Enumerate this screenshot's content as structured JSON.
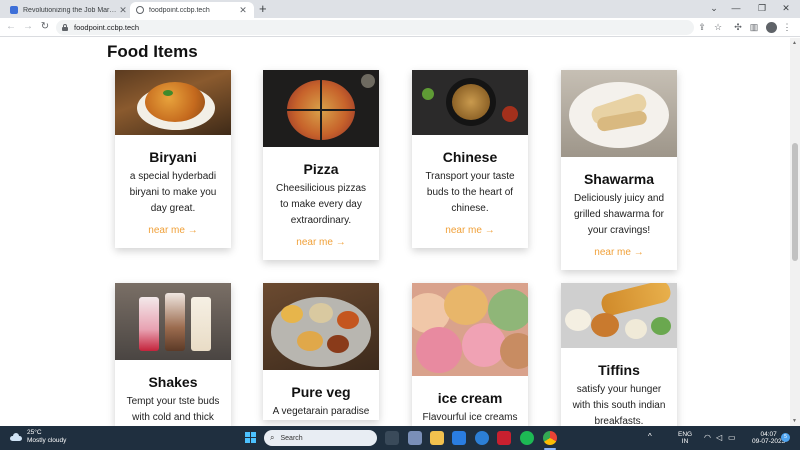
{
  "browser": {
    "tabs": [
      {
        "title": "Revolutionizing the Job Market |",
        "active": false
      },
      {
        "title": "foodpoint.ccbp.tech",
        "active": true
      }
    ],
    "new_tab": "+",
    "url": "foodpoint.ccbp.tech",
    "window_controls": [
      "⌄",
      "—",
      "❐",
      "✕"
    ]
  },
  "page": {
    "section_title": "Food Items",
    "cards": [
      {
        "name": "Biryani",
        "description": "a special hyderbadi biryani to make you day great.",
        "cta": "near me →"
      },
      {
        "name": "Pizza",
        "description": "Cheesilicious pizzas to make every day extraordinary.",
        "cta": "near me →"
      },
      {
        "name": "Chinese",
        "description": "Transport your taste buds to the heart of chinese.",
        "cta": "near me →"
      },
      {
        "name": "Shawarma",
        "description": "Deliciously juicy and grilled shawarma for your cravings!",
        "cta": "near me →"
      },
      {
        "name": "Shakes",
        "description": "Tempt your tste buds with cold and thick",
        "cta": ""
      },
      {
        "name": "Pure veg",
        "description": "A vegetarain paradise",
        "cta": ""
      },
      {
        "name": "ice cream",
        "description": "Flavourful ice creams",
        "cta": ""
      },
      {
        "name": "Tiffins",
        "description": "satisfy your hunger with this south indian breakfasts.",
        "cta": ""
      }
    ]
  },
  "taskbar": {
    "weather_temp": "25°C",
    "weather_desc": "Mostly cloudy",
    "search_placeholder": "Search",
    "language_line1": "ENG",
    "language_line2": "IN",
    "time": "04:07",
    "date": "09-07-2023",
    "notification_count": "5",
    "tray_arrow": "^"
  },
  "colors": {
    "cta": "#f0a13a",
    "taskbar": "#1f2f3f",
    "tabstrip": "#dee1e6"
  }
}
